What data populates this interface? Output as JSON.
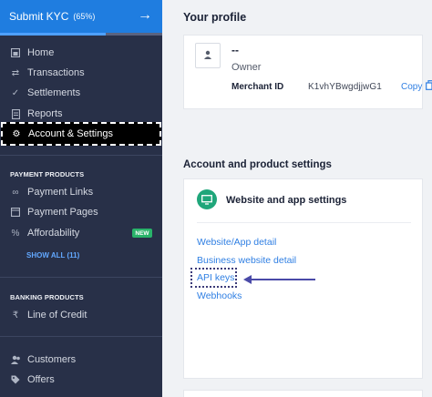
{
  "kyc": {
    "label": "Submit KYC",
    "percent": "(65%)",
    "progress": 0.65
  },
  "nav": {
    "home": "Home",
    "transactions": "Transactions",
    "settlements": "Settlements",
    "reports": "Reports",
    "account_settings": "Account & Settings"
  },
  "payment_products": {
    "heading": "PAYMENT PRODUCTS",
    "payment_links": "Payment Links",
    "payment_pages": "Payment Pages",
    "affordability": "Affordability",
    "new_badge": "NEW",
    "show_all": "SHOW ALL (11)"
  },
  "banking_products": {
    "heading": "BANKING PRODUCTS",
    "line_of_credit": "Line of Credit"
  },
  "bottom_nav": {
    "customers": "Customers",
    "offers": "Offers"
  },
  "profile": {
    "title": "Your profile",
    "name": "--",
    "role": "Owner",
    "merchant_id_label": "Merchant ID",
    "merchant_id": "K1vhYBwgdjjwG1",
    "copy_label": "Copy"
  },
  "settings": {
    "title": "Account and product settings",
    "card_title": "Website and app settings",
    "links": {
      "website_app_detail": "Website/App detail",
      "business_website_detail": "Business website detail",
      "api_keys": "API keys",
      "webhooks": "Webhooks"
    }
  },
  "colors": {
    "sidebar_bg": "#283048",
    "kyc_bg": "#1f7de0",
    "link": "#2f7fe3",
    "new_badge": "#29b36a",
    "highlight": "#3b3a78"
  },
  "icons": {
    "kyc_arrow": "arrow-right-icon",
    "home": "home-icon",
    "transactions": "arrows-exchange-icon",
    "settlements": "check-icon",
    "reports": "document-icon",
    "account_settings": "gear-icon",
    "payment_links": "link-icon",
    "payment_pages": "page-icon",
    "affordability": "percent-tag-icon",
    "line_of_credit": "rupee-icon",
    "customers": "users-icon",
    "offers": "tag-icon",
    "avatar": "user-icon",
    "copy": "copy-icon",
    "website": "monitor-icon"
  }
}
